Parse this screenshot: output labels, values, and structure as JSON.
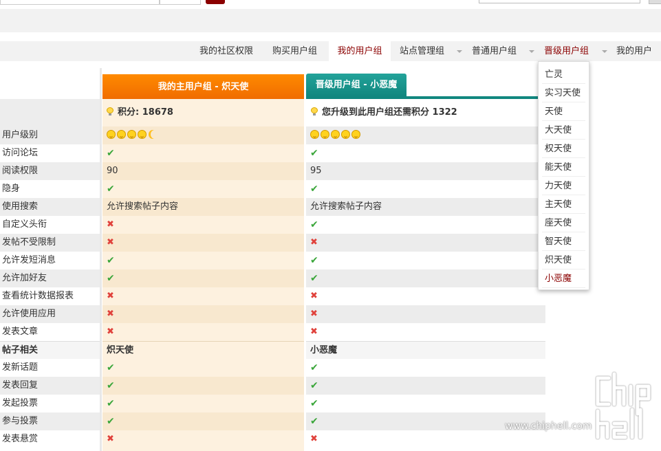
{
  "nav": {
    "tabs": [
      {
        "label": "我的社区权限"
      },
      {
        "label": "购买用户组"
      },
      {
        "label": "我的用户组"
      },
      {
        "label": "站点管理组"
      },
      {
        "label": "普通用户组"
      },
      {
        "label": "晋级用户组"
      },
      {
        "label": "我的用户"
      }
    ]
  },
  "main_group": {
    "header": "我的主用户组 - 炽天使",
    "summary": "积分: 18678"
  },
  "next_group": {
    "header": "晋级用户组 - 小恶魔",
    "summary": "您升级到此用户组还需积分 1322"
  },
  "rows": [
    {
      "label": "用户级别",
      "main": "stars",
      "next": "stars"
    },
    {
      "label": "访问论坛",
      "main": "yes",
      "next": "yes"
    },
    {
      "label": "阅读权限",
      "main": "90",
      "next": "95"
    },
    {
      "label": "隐身",
      "main": "yes",
      "next": "yes"
    },
    {
      "label": "使用搜索",
      "main": "允许搜索帖子内容",
      "next": "允许搜索帖子内容"
    },
    {
      "label": "自定义头衔",
      "main": "no",
      "next": "yes"
    },
    {
      "label": "发帖不受限制",
      "main": "no",
      "next": "no"
    },
    {
      "label": "允许发短消息",
      "main": "yes",
      "next": "yes"
    },
    {
      "label": "允许加好友",
      "main": "yes",
      "next": "yes"
    },
    {
      "label": "查看统计数据报表",
      "main": "no",
      "next": "no"
    },
    {
      "label": "允许使用应用",
      "main": "no",
      "next": "no"
    },
    {
      "label": "发表文章",
      "main": "no",
      "next": "no"
    },
    {
      "label": "帖子相关",
      "main": "炽天使",
      "next": "小恶魔",
      "section": true
    },
    {
      "label": "发新话题",
      "main": "yes",
      "next": "yes"
    },
    {
      "label": "发表回复",
      "main": "yes",
      "next": "yes"
    },
    {
      "label": "发起投票",
      "main": "yes",
      "next": "yes"
    },
    {
      "label": "参与投票",
      "main": "yes",
      "next": "yes"
    },
    {
      "label": "发表悬赏",
      "main": "no",
      "next": "no"
    }
  ],
  "dropdown": {
    "items": [
      "亡灵",
      "实习天使",
      "天使",
      "大天使",
      "权天使",
      "能天使",
      "力天使",
      "主天使",
      "座天使",
      "智天使",
      "炽天使",
      "小恶魔"
    ],
    "current_index": 11
  },
  "icons": {
    "yes": "check-icon",
    "no": "cross-icon",
    "summary": "bulb-icon"
  },
  "watermark": {
    "text": "www.chiphell.com"
  },
  "colors": {
    "accent": "#8b0000",
    "main_header": "#ff8a00",
    "next_header": "#11877f"
  }
}
